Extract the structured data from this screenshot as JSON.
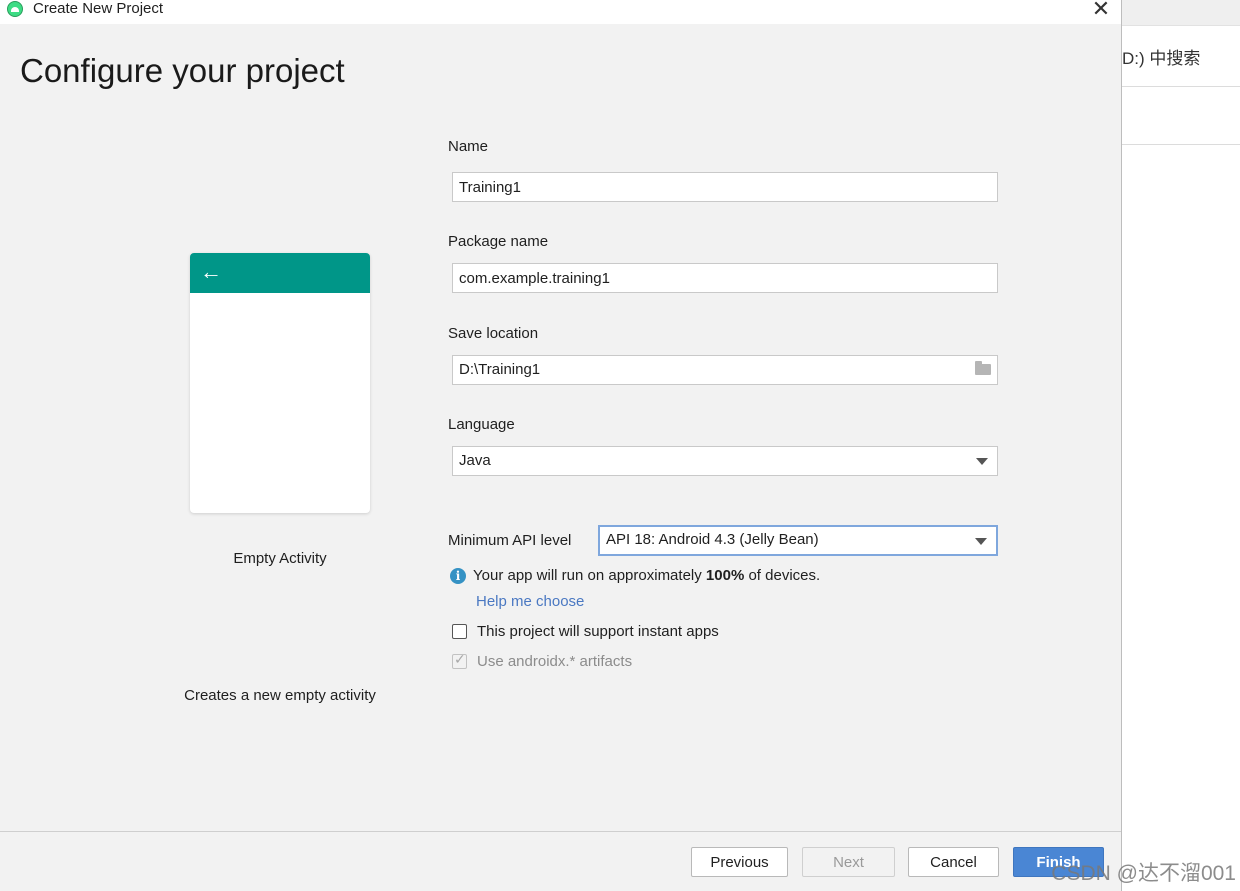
{
  "background_window": {
    "search_text": "D:) 中搜索",
    "watermark": "CSDN @达不溜001"
  },
  "dialog": {
    "title": "Create New Project",
    "page_title": "Configure your project"
  },
  "template": {
    "name": "Empty Activity",
    "description": "Creates a new empty activity",
    "toolbar_color": "#009688",
    "back_icon": "back-arrow-icon"
  },
  "form": {
    "name_label": "Name",
    "name_value": "Training1",
    "package_label": "Package name",
    "package_value": "com.example.training1",
    "location_label": "Save location",
    "location_value": "D:\\Training1",
    "language_label": "Language",
    "language_value": "Java",
    "min_api_label": "Minimum API level",
    "min_api_value": "API 18: Android 4.3 (Jelly Bean)",
    "info_prefix": "Your app will run on approximately ",
    "info_percent": "100%",
    "info_suffix": " of devices.",
    "help_link": "Help me choose",
    "instant_apps_label": "This project will support instant apps",
    "instant_apps_checked": false,
    "androidx_label": "Use androidx.* artifacts",
    "androidx_checked": true
  },
  "footer": {
    "previous": "Previous",
    "next": "Next",
    "cancel": "Cancel",
    "finish": "Finish"
  },
  "colors": {
    "accent": "#4a86d4",
    "link": "#4a78c2",
    "info": "#3592c4"
  }
}
